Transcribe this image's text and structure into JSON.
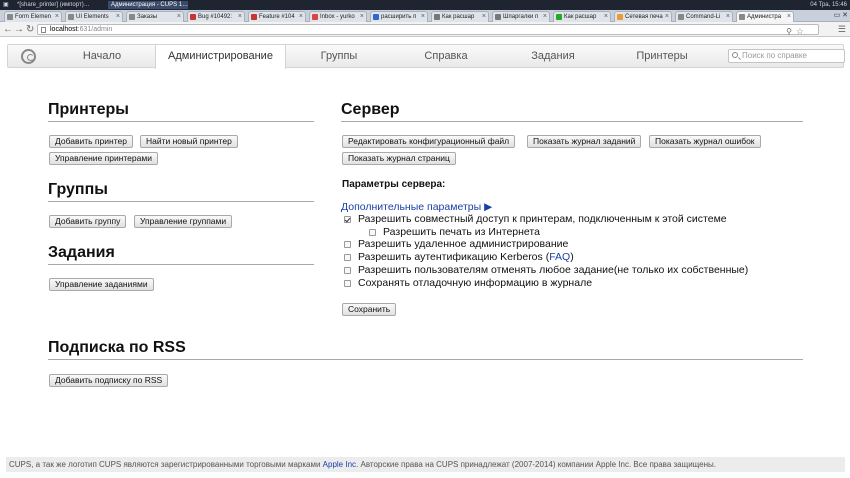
{
  "taskbar": {
    "items": [
      {
        "label": "*[share_printer] (импорт)…"
      },
      {
        "label": "Администрация - CUPS 1…"
      }
    ],
    "clock": "04 Тра, 15:46"
  },
  "tabs": [
    {
      "label": "Form Elemen"
    },
    {
      "label": "UI Elements"
    },
    {
      "label": "Заказы"
    },
    {
      "label": "Bug #10492:"
    },
    {
      "label": "Feature #104"
    },
    {
      "label": "Inbox - yurko"
    },
    {
      "label": "расширить п"
    },
    {
      "label": "Как расшар"
    },
    {
      "label": "Шпаргалки п"
    },
    {
      "label": "Как расшар"
    },
    {
      "label": "Сетевая печа"
    },
    {
      "label": "Command-Li"
    },
    {
      "label": "Администра"
    }
  ],
  "address": {
    "host": "localhost",
    "path": ":631/admin"
  },
  "nav": {
    "items": [
      {
        "label": "Начало"
      },
      {
        "label": "Администрирование"
      },
      {
        "label": "Группы"
      },
      {
        "label": "Справка"
      },
      {
        "label": "Задания"
      },
      {
        "label": "Принтеры"
      }
    ],
    "search_placeholder": "Поиск по справке"
  },
  "printers": {
    "title": "Принтеры",
    "buttons": [
      "Добавить принтер",
      "Найти новый принтер",
      "Управление принтерами"
    ]
  },
  "groups": {
    "title": "Группы",
    "buttons": [
      "Добавить группу",
      "Управление группами"
    ]
  },
  "jobs": {
    "title": "Задания",
    "buttons": [
      "Управление заданиями"
    ]
  },
  "rss": {
    "title": "Подписка по RSS",
    "buttons": [
      "Добавить подписку по RSS"
    ]
  },
  "server": {
    "title": "Сервер",
    "buttons": [
      "Редактировать конфигурационный файл",
      "Показать журнал заданий",
      "Показать журнал ошибок",
      "Показать журнал страниц"
    ],
    "settings_label": "Параметры сервера:",
    "advanced_link": "Дополнительные параметры ▶",
    "options": [
      {
        "label": "Разрешить совместный доступ к принтерам, подключенным к этой системе",
        "checked": true
      },
      {
        "label": "Разрешить печать из Интернета",
        "checked": false
      },
      {
        "label": "Разрешить удаленное администрирование",
        "checked": false
      },
      {
        "label_pre": "Разрешить аутентификацию Kerberos (",
        "label_link": "FAQ",
        "label_post": ")",
        "checked": false
      },
      {
        "label": "Разрешить пользователям отменять любое задание(не только их собственные)",
        "checked": false
      },
      {
        "label": "Сохранять отладочную информацию в журнале",
        "checked": false
      }
    ],
    "save_button": "Сохранить"
  },
  "footer": {
    "pre": "CUPS, а так же логотип CUPS являются зарегистрированными торговыми марками ",
    "link": "Apple Inc",
    "post": ". Авторские права на CUPS принадлежат (2007-2014) компании Apple Inc. Все права защищены."
  }
}
